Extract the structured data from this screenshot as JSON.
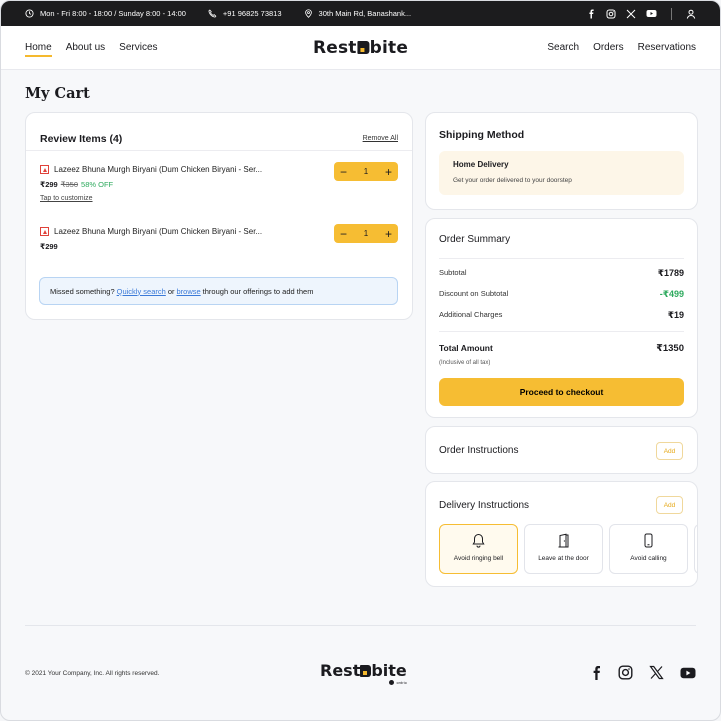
{
  "topbar": {
    "hours": "Mon - Fri 8:00 - 18:00 / Sunday 8:00 - 14:00",
    "phone": "+91 96825 73813",
    "address": "30th Main Rd, Banashank..."
  },
  "nav": {
    "left": [
      "Home",
      "About us",
      "Services"
    ],
    "right": [
      "Search",
      "Orders",
      "Reservations"
    ],
    "logo": "Restobite"
  },
  "page_title": "My Cart",
  "review": {
    "title": "Review Items (4)",
    "remove_all": "Remove All",
    "items": [
      {
        "name": "Lazeez Bhuna Murgh Biryani (Dum Chicken Biryani - Ser...",
        "price": "₹299",
        "old_price": "₹350",
        "discount": "58% OFF",
        "customize": "Tap to customize",
        "qty": "1"
      },
      {
        "name": "Lazeez Bhuna Murgh Biryani (Dum Chicken Biryani - Ser...",
        "price": "₹299",
        "qty": "1"
      }
    ],
    "missed": {
      "prefix": "Missed something?",
      "link1": "Quickly search",
      "mid": "or",
      "link2": "browse",
      "suffix": "through our offerings to add them"
    }
  },
  "shipping": {
    "title": "Shipping Method",
    "option_title": "Home Delivery",
    "option_desc": "Get your order delivered to your doorstep"
  },
  "summary": {
    "title": "Order Summary",
    "subtotal_label": "Subtotal",
    "subtotal": "₹1789",
    "discount_label": "Discount on Subtotal",
    "discount": "-₹499",
    "charges_label": "Additional Charges",
    "charges": "₹19",
    "total_label": "Total Amount",
    "total": "₹1350",
    "tax_note": "(Inclusive of all tax)",
    "checkout": "Proceed to checkout"
  },
  "order_instructions": {
    "title": "Order Instructions",
    "add": "Add"
  },
  "delivery_instructions": {
    "title": "Delivery Instructions",
    "add": "Add",
    "options": [
      "Avoid ringing bell",
      "Leave at the door",
      "Avoid calling"
    ]
  },
  "footer": {
    "copyright": "© 2021 Your Company, Inc. All rights reserved.",
    "logo": "Restobite",
    "logo_tag": "ordrio"
  },
  "colors": {
    "accent": "#f6bd33",
    "green": "#2eaa5e",
    "link": "#3b7ad8",
    "dark": "#1c1c1e"
  }
}
